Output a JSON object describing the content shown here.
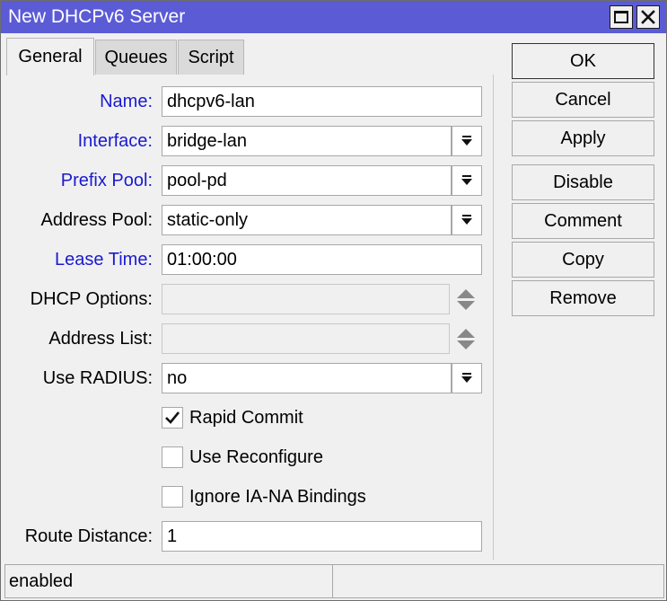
{
  "window": {
    "title": "New DHCPv6 Server",
    "title_bar_color": "#5b5bd6",
    "controls": [
      "maximize-icon",
      "close-icon"
    ],
    "close_glyph": "✕"
  },
  "tabs": [
    {
      "label": "General",
      "active": true
    },
    {
      "label": "Queues",
      "active": false
    },
    {
      "label": "Script",
      "active": false
    }
  ],
  "form": {
    "name": {
      "label": "Name:",
      "value": "dhcpv6-lan"
    },
    "interface": {
      "label": "Interface:",
      "value": "bridge-lan"
    },
    "prefix_pool": {
      "label": "Prefix Pool:",
      "value": "pool-pd"
    },
    "address_pool": {
      "label": "Address Pool:",
      "value": "static-only"
    },
    "lease_time": {
      "label": "Lease Time:",
      "value": "01:00:00"
    },
    "dhcp_options": {
      "label": "DHCP Options:",
      "value": ""
    },
    "address_list": {
      "label": "Address List:",
      "value": ""
    },
    "use_radius": {
      "label": "Use RADIUS:",
      "value": "no"
    },
    "rapid_commit": {
      "label": "Rapid Commit",
      "checked": true
    },
    "use_reconfigure": {
      "label": "Use Reconfigure",
      "checked": false
    },
    "ignore_ia_na": {
      "label": "Ignore IA-NA Bindings",
      "checked": false
    },
    "route_distance": {
      "label": "Route Distance:",
      "value": "1"
    },
    "label_highlight_color": "#1a1ad0"
  },
  "buttons": {
    "ok": "OK",
    "cancel": "Cancel",
    "apply": "Apply",
    "disable": "Disable",
    "comment": "Comment",
    "copy": "Copy",
    "remove": "Remove"
  },
  "status": {
    "text": "enabled"
  }
}
